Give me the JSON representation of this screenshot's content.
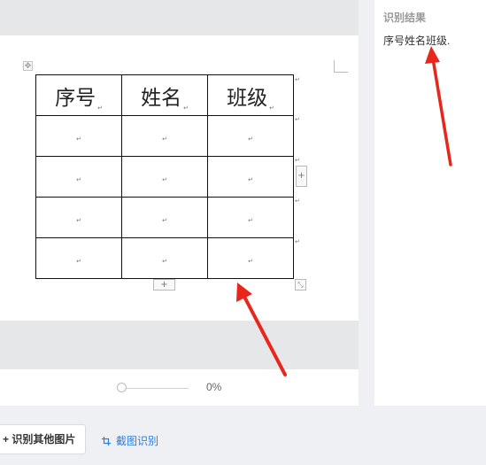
{
  "document": {
    "table": {
      "header": [
        "序号",
        "姓名",
        "班级"
      ],
      "paragraph_mark": "↵",
      "empty_rows": 4
    },
    "add_button_symbol": "+"
  },
  "zoom": {
    "value_label": "0%",
    "level_fraction": 0
  },
  "result": {
    "title": "识别结果",
    "text": "序号姓名班级."
  },
  "actions": {
    "recognize_other_label": "识别其他图片",
    "screenshot_recognize_label": "截图识别"
  },
  "colors": {
    "annotation_arrow": "#e8261c",
    "link_blue": "#2e7de1",
    "panel_gray": "#e6e7e9"
  },
  "icons": {
    "move": "move-icon",
    "crop": "crop-icon",
    "resize": "resize-icon"
  }
}
